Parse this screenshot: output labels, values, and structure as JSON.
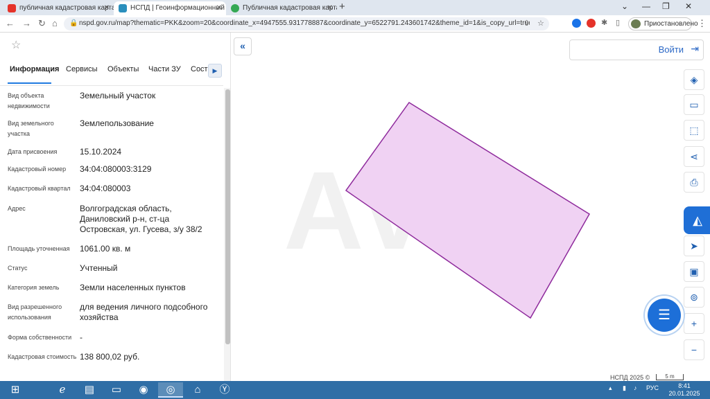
{
  "browser": {
    "tabs": [
      {
        "title": "публичная кадастровая карта",
        "active": false,
        "favicon": "yandex-icon"
      },
      {
        "title": "НСПД | Геоинформационный п",
        "active": true,
        "favicon": "nspd-icon"
      },
      {
        "title": "Публичная кадастровая карта",
        "active": false,
        "favicon": "check-icon"
      }
    ],
    "url": "nspd.gov.ru/map?thematic=PKK&zoom=20&coordinate_x=4947555.931778887&coordinate_y=6522791.243601742&theme_id=1&is_copy_url=true&baseLa...",
    "profile_status": "Приостановлено"
  },
  "panel": {
    "tabs": [
      "Информация",
      "Сервисы",
      "Объекты",
      "Части ЗУ",
      "Состо"
    ],
    "active_tab": "Информация",
    "rows": [
      {
        "label": "Вид объекта недвижимости",
        "value": "Земельный участок"
      },
      {
        "label": "Вид земельного участка",
        "value": "Землепользование"
      },
      {
        "label": "Дата присвоения",
        "value": "15.10.2024"
      },
      {
        "label": "Кадастровый номер",
        "value": "34:04:080003:3129"
      },
      {
        "label": "Кадастровый квартал",
        "value": "34:04:080003"
      },
      {
        "label": "Адрес",
        "value": "Волгоградская область, Даниловский р-н, ст-ца Островская, ул. Гусева, з/у 38/2"
      },
      {
        "label": "Площадь уточненная",
        "value": "1061.00 кв. м"
      },
      {
        "label": "Статус",
        "value": "Учтенный"
      },
      {
        "label": "Категория земель",
        "value": "Земли населенных пунктов"
      },
      {
        "label": "Вид разрешенного использования",
        "value": "для ведения личного подсобного хозяйства"
      },
      {
        "label": "Форма собственности",
        "value": "-"
      },
      {
        "label": "Кадастровая стоимость",
        "value": "138 800,02 руб."
      }
    ]
  },
  "map": {
    "login_label": "Войти",
    "watermark": "Avito",
    "attribution": "НСПД 2025 ©",
    "scale_label": "5 m",
    "parcel_fill": "#f0d2f3",
    "parcel_stroke": "#8e2a9c",
    "tools": [
      "layers-icon",
      "ruler-icon",
      "select-area-icon",
      "share-icon",
      "print-icon",
      "nspd-logo-icon",
      "locate-icon",
      "screen-icon",
      "geo-search-icon",
      "zoom-in-icon",
      "zoom-out-icon"
    ]
  },
  "taskbar": {
    "lang": "РУС",
    "time": "8:41",
    "date": "20.01.2025"
  }
}
